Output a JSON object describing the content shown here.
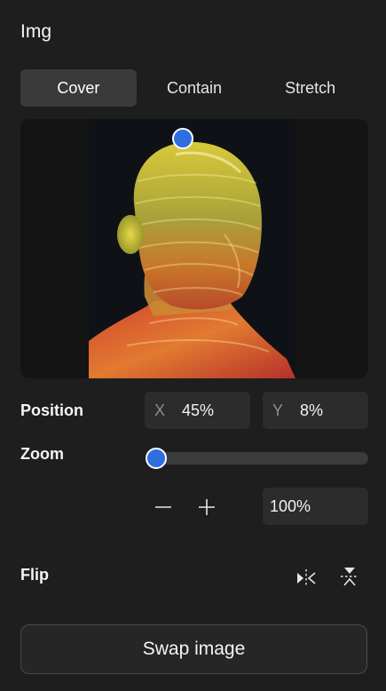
{
  "panel": {
    "title": "Img"
  },
  "fit_modes": {
    "options": [
      "Cover",
      "Contain",
      "Stretch"
    ],
    "selected": "Cover"
  },
  "preview": {
    "image_subject": "glass-head-sculpture",
    "focal_point": {
      "x_percent": 45,
      "y_percent": 8
    }
  },
  "position": {
    "label": "Position",
    "x_axis": "X",
    "x_value": "45%",
    "y_axis": "Y",
    "y_value": "8%"
  },
  "zoom": {
    "label": "Zoom",
    "slider_fraction": 0.0,
    "minus_icon": "minus-icon",
    "plus_icon": "plus-icon",
    "value": "100%"
  },
  "flip": {
    "label": "Flip",
    "horizontal_icon": "flip-horizontal-icon",
    "vertical_icon": "flip-vertical-icon"
  },
  "actions": {
    "swap_label": "Swap image"
  },
  "colors": {
    "background": "#1e1e1e",
    "accent": "#2f6de1",
    "field": "#2c2c2c",
    "active_segment": "#3a3a3a"
  }
}
